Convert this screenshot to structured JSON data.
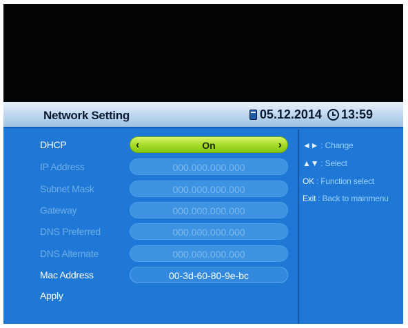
{
  "header": {
    "title": "Network Setting",
    "date": "05.12.2014",
    "time": "13:59"
  },
  "settings": [
    {
      "label": "DHCP",
      "value": "On"
    },
    {
      "label": "IP Address",
      "value": "000.000.000.000"
    },
    {
      "label": "Subnet Mask",
      "value": "000.000.000.000"
    },
    {
      "label": "Gateway",
      "value": "000.000.000.000"
    },
    {
      "label": "DNS Preferred",
      "value": "000.000.000.000"
    },
    {
      "label": "DNS Alternate",
      "value": "000.000.000.000"
    },
    {
      "label": "Mac Address",
      "value": "00-3d-60-80-9e-bc"
    }
  ],
  "apply_label": "Apply",
  "help": [
    {
      "key": "◄►",
      "text": ": Change"
    },
    {
      "key": "▲▼",
      "text": ": Select"
    },
    {
      "key": "OK",
      "text": ": Function select"
    },
    {
      "key": "Exit",
      "text": ": Back to mainmenu"
    }
  ],
  "colors": {
    "panel": "#1f78d6",
    "header": "#bcd6ee",
    "selected": "#a8dc2a"
  }
}
